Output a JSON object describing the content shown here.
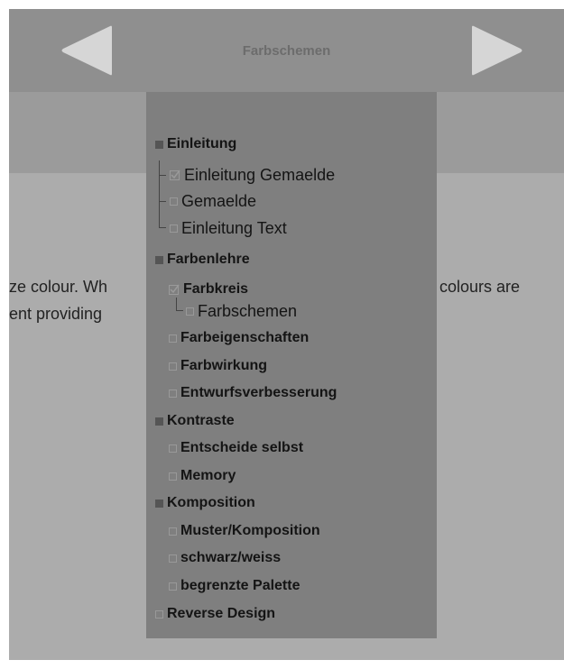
{
  "header": {
    "title": "Farbschemen",
    "prev_icon": "triangle-left-icon",
    "next_icon": "triangle-right-icon"
  },
  "content": {
    "line1_left": "ze colour. Wh",
    "line1_right": "e colours are",
    "line2_left": "ent providing"
  },
  "menu": {
    "sections": [
      {
        "label": "Einleitung",
        "items": [
          {
            "label": "Einleitung Gemaelde",
            "state": "checked"
          },
          {
            "label": "Gemaelde",
            "state": "unchecked"
          },
          {
            "label": "Einleitung Text",
            "state": "unchecked"
          }
        ]
      },
      {
        "label": "Farbenlehre",
        "items": [
          {
            "label": "Farbkreis",
            "state": "checked"
          },
          {
            "label": "Farbschemen",
            "state": "unchecked"
          },
          {
            "label": "Farbeigenschaften",
            "state": "unchecked"
          },
          {
            "label": "Farbwirkung",
            "state": "unchecked"
          },
          {
            "label": "Entwurfsverbesserung",
            "state": "unchecked"
          }
        ]
      },
      {
        "label": "Kontraste",
        "items": [
          {
            "label": "Entscheide selbst",
            "state": "unchecked"
          },
          {
            "label": "Memory",
            "state": "unchecked"
          }
        ]
      },
      {
        "label": "Komposition",
        "items": [
          {
            "label": "Muster/Komposition",
            "state": "unchecked"
          },
          {
            "label": "schwarz/weiss",
            "state": "unchecked"
          },
          {
            "label": "begrenzte Palette",
            "state": "unchecked"
          }
        ]
      },
      {
        "label": "Reverse Design",
        "items": []
      }
    ]
  },
  "colors": {
    "frame_bg": "#acacac",
    "topbar_bg": "#8f8f8f",
    "menu_bg": "#7f7f7f",
    "text": "#141414",
    "nav_arrow": "#d6d6d6"
  }
}
